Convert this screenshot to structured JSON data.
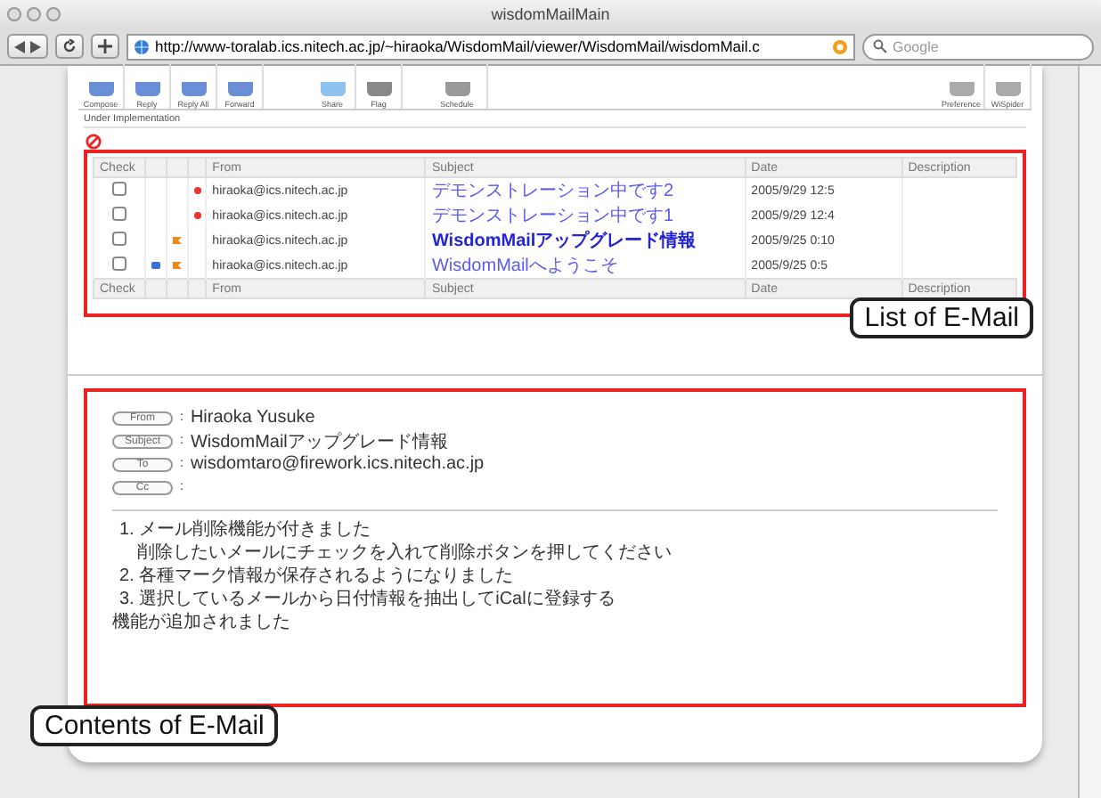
{
  "window": {
    "title": "wisdomMailMain"
  },
  "browser": {
    "url": "http://www-toralab.ics.nitech.ac.jp/~hiraoka/WisdomMail/viewer/WisdomMail/wisdomMail.c",
    "search_placeholder": "Google"
  },
  "toolbar": {
    "buttons": [
      {
        "label": "Compose"
      },
      {
        "label": "Reply"
      },
      {
        "label": "Reply All"
      },
      {
        "label": "Forward"
      },
      {
        "label": "Share"
      },
      {
        "label": "Flag"
      },
      {
        "label": "Schedule"
      }
    ],
    "right_buttons": [
      {
        "label": "Preference"
      },
      {
        "label": "WiSpider"
      }
    ]
  },
  "status": "Under Implementation",
  "mail_list": {
    "columns": [
      "Check",
      "From",
      "Subject",
      "Date",
      "Description"
    ],
    "rows": [
      {
        "checked": false,
        "replied": false,
        "flagged": false,
        "unread": true,
        "selected": false,
        "from": "hiraoka@ics.nitech.ac.jp",
        "subject": "デモンストレーション中です2",
        "date": "2005/9/29 12:5"
      },
      {
        "checked": false,
        "replied": false,
        "flagged": false,
        "unread": true,
        "selected": false,
        "from": "hiraoka@ics.nitech.ac.jp",
        "subject": "デモンストレーション中です1",
        "date": "2005/9/29 12:4"
      },
      {
        "checked": false,
        "replied": false,
        "flagged": true,
        "unread": false,
        "selected": true,
        "from": "hiraoka@ics.nitech.ac.jp",
        "subject": "WisdomMailアップグレード情報",
        "date": "2005/9/25 0:10"
      },
      {
        "checked": false,
        "replied": true,
        "flagged": true,
        "unread": false,
        "selected": false,
        "from": "hiraoka@ics.nitech.ac.jp",
        "subject": "WisdomMailへようこそ",
        "date": "2005/9/25 0:5"
      }
    ],
    "footer_columns": [
      "Check",
      "From",
      "Subject",
      "Date",
      "Description"
    ],
    "annotation": "List of E-Mail"
  },
  "mail_view": {
    "headers": [
      {
        "label": "From",
        "colon": ":",
        "value": "Hiraoka Yusuke"
      },
      {
        "label": "Subject",
        "colon": ":",
        "value": "WisdomMailアップグレード情報"
      },
      {
        "label": "To",
        "colon": ":",
        "value": "wisdomtaro@firework.ics.nitech.ac.jp"
      },
      {
        "label": "Cc",
        "colon": ":"
      }
    ],
    "body": [
      {
        "kind": "numbered",
        "text": "1. メール削除機能が付きました"
      },
      {
        "kind": "indented",
        "text": "削除したいメールにチェックを入れて削除ボタンを押してください"
      },
      {
        "kind": "numbered",
        "text": "2. 各種マーク情報が保存されるようになりました"
      },
      {
        "kind": "numbered",
        "text": "3. 選択しているメールから日付情報を抽出してiCalに登録する"
      },
      {
        "kind": "plain",
        "text": "機能が追加されました"
      }
    ],
    "annotation": "Contents of E-Mail"
  }
}
